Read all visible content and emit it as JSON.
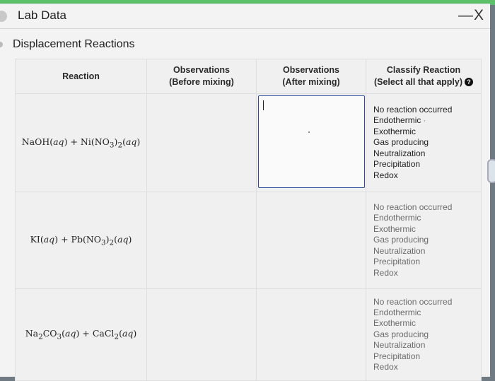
{
  "window": {
    "title": "Lab Data",
    "minimize_label": "—",
    "close_label": "X"
  },
  "section_title": "Displacement Reactions",
  "table": {
    "headers": {
      "reaction": "Reaction",
      "before_line1": "Observations",
      "before_line2": "(Before mixing)",
      "after_line1": "Observations",
      "after_line2": "(After mixing)",
      "classify_line1": "Classify Reaction",
      "classify_line2": "(Select all that apply)"
    },
    "classification_options": [
      "No reaction occurred",
      "Endothermic",
      "Exothermic",
      "Gas producing",
      "Neutralization",
      "Precipitation",
      "Redox"
    ],
    "rows": [
      {
        "reactant1": "NaOH(aq)",
        "reactant2": "Ni(NO3)2(aq)",
        "before_value": "",
        "after_value": ""
      },
      {
        "reactant1": "KI(aq)",
        "reactant2": "Pb(NO3)2(aq)",
        "before_value": "",
        "after_value": ""
      },
      {
        "reactant1": "Na2CO3(aq)",
        "reactant2": "CaCl2(aq)",
        "before_value": "",
        "after_value": ""
      }
    ],
    "plus": "+"
  },
  "icons": {
    "help": "question-circle-icon"
  },
  "colors": {
    "accent_strip": "#5cc06a",
    "focus_border": "#2d4d9c"
  }
}
